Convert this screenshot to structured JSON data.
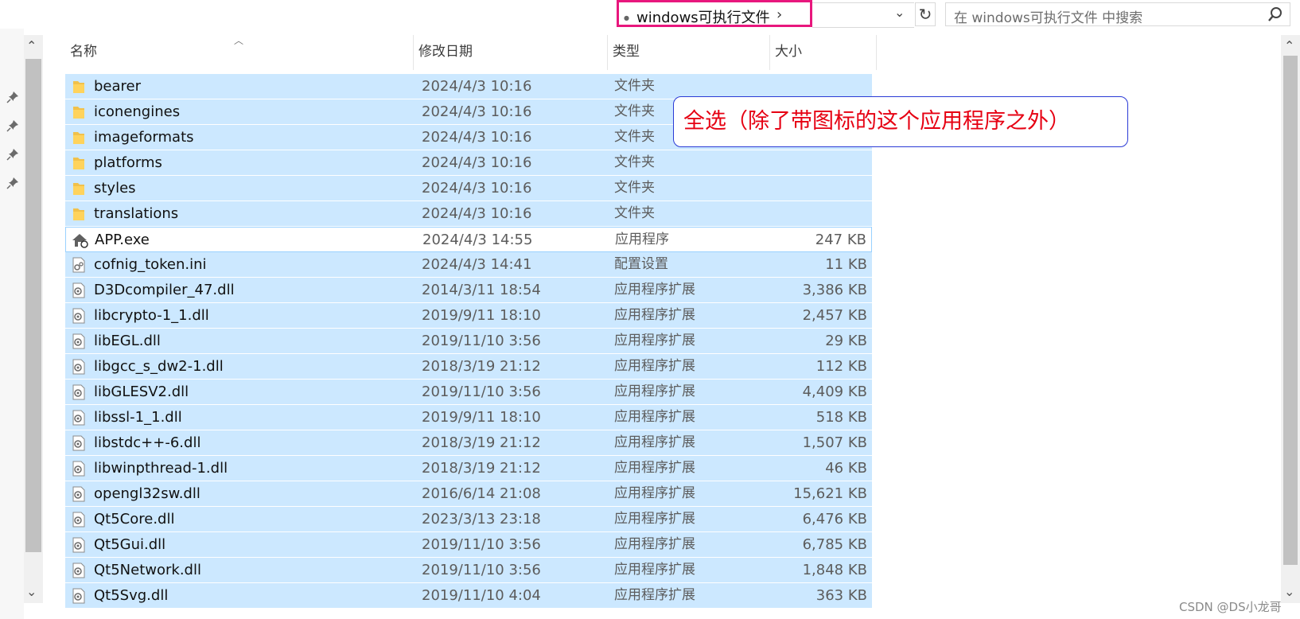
{
  "address": {
    "current_folder": "windows可执行文件",
    "chevron": "›"
  },
  "search": {
    "placeholder": "在 windows可执行文件 中搜索"
  },
  "columns": {
    "name": "名称",
    "date": "修改日期",
    "type": "类型",
    "size": "大小"
  },
  "files": [
    {
      "name": "bearer",
      "date": "2024/4/3 10:16",
      "type": "文件夹",
      "size": "",
      "icon": "folder-icon",
      "selected": true
    },
    {
      "name": "iconengines",
      "date": "2024/4/3 10:16",
      "type": "文件夹",
      "size": "",
      "icon": "folder-icon",
      "selected": true
    },
    {
      "name": "imageformats",
      "date": "2024/4/3 10:16",
      "type": "文件夹",
      "size": "",
      "icon": "folder-icon",
      "selected": true
    },
    {
      "name": "platforms",
      "date": "2024/4/3 10:16",
      "type": "文件夹",
      "size": "",
      "icon": "folder-icon",
      "selected": true
    },
    {
      "name": "styles",
      "date": "2024/4/3 10:16",
      "type": "文件夹",
      "size": "",
      "icon": "folder-icon",
      "selected": true
    },
    {
      "name": "translations",
      "date": "2024/4/3 10:16",
      "type": "文件夹",
      "size": "",
      "icon": "folder-icon",
      "selected": true
    },
    {
      "name": "APP.exe",
      "date": "2024/4/3 14:55",
      "type": "应用程序",
      "size": "247 KB",
      "icon": "app-icon",
      "selected": false
    },
    {
      "name": "cofnig_token.ini",
      "date": "2024/4/3 14:41",
      "type": "配置设置",
      "size": "11 KB",
      "icon": "settings-file-icon",
      "selected": true
    },
    {
      "name": "D3Dcompiler_47.dll",
      "date": "2014/3/11 18:54",
      "type": "应用程序扩展",
      "size": "3,386 KB",
      "icon": "dll-file-icon",
      "selected": true
    },
    {
      "name": "libcrypto-1_1.dll",
      "date": "2019/9/11 18:10",
      "type": "应用程序扩展",
      "size": "2,457 KB",
      "icon": "dll-file-icon",
      "selected": true
    },
    {
      "name": "libEGL.dll",
      "date": "2019/11/10 3:56",
      "type": "应用程序扩展",
      "size": "29 KB",
      "icon": "dll-file-icon",
      "selected": true
    },
    {
      "name": "libgcc_s_dw2-1.dll",
      "date": "2018/3/19 21:12",
      "type": "应用程序扩展",
      "size": "112 KB",
      "icon": "dll-file-icon",
      "selected": true
    },
    {
      "name": "libGLESV2.dll",
      "date": "2019/11/10 3:56",
      "type": "应用程序扩展",
      "size": "4,409 KB",
      "icon": "dll-file-icon",
      "selected": true
    },
    {
      "name": "libssl-1_1.dll",
      "date": "2019/9/11 18:10",
      "type": "应用程序扩展",
      "size": "518 KB",
      "icon": "dll-file-icon",
      "selected": true
    },
    {
      "name": "libstdc++-6.dll",
      "date": "2018/3/19 21:12",
      "type": "应用程序扩展",
      "size": "1,507 KB",
      "icon": "dll-file-icon",
      "selected": true
    },
    {
      "name": "libwinpthread-1.dll",
      "date": "2018/3/19 21:12",
      "type": "应用程序扩展",
      "size": "46 KB",
      "icon": "dll-file-icon",
      "selected": true
    },
    {
      "name": "opengl32sw.dll",
      "date": "2016/6/14 21:08",
      "type": "应用程序扩展",
      "size": "15,621 KB",
      "icon": "dll-file-icon",
      "selected": true
    },
    {
      "name": "Qt5Core.dll",
      "date": "2023/3/13 23:18",
      "type": "应用程序扩展",
      "size": "6,476 KB",
      "icon": "dll-file-icon",
      "selected": true
    },
    {
      "name": "Qt5Gui.dll",
      "date": "2019/11/10 3:56",
      "type": "应用程序扩展",
      "size": "6,785 KB",
      "icon": "dll-file-icon",
      "selected": true
    },
    {
      "name": "Qt5Network.dll",
      "date": "2019/11/10 3:56",
      "type": "应用程序扩展",
      "size": "1,848 KB",
      "icon": "dll-file-icon",
      "selected": true
    },
    {
      "name": "Qt5Svg.dll",
      "date": "2019/11/10 4:04",
      "type": "应用程序扩展",
      "size": "363 KB",
      "icon": "dll-file-icon",
      "selected": true
    }
  ],
  "annotation": {
    "text": "全选（除了带图标的这个应用程序之外）",
    "text_color": "#e60012",
    "border_color": "#2a3ad6"
  },
  "colors": {
    "selection": "#cce8ff",
    "highlight_border": "#e8177d"
  },
  "watermark": "CSDN @DS小龙哥"
}
